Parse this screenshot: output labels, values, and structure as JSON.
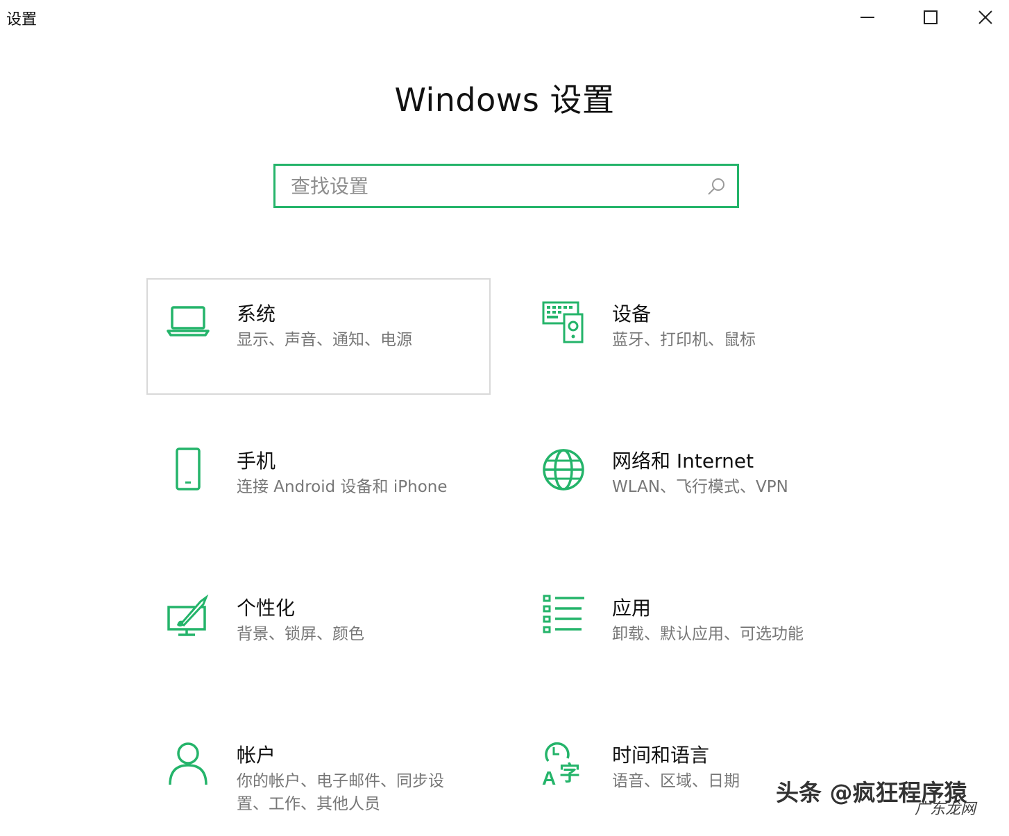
{
  "window": {
    "title": "设置"
  },
  "page": {
    "title": "Windows 设置"
  },
  "search": {
    "placeholder": "查找设置",
    "value": ""
  },
  "accent_color": "#24b46a",
  "tiles": [
    {
      "title": "系统",
      "desc": "显示、声音、通知、电源",
      "icon": "laptop-icon",
      "selected": true
    },
    {
      "title": "设备",
      "desc": "蓝牙、打印机、鼠标",
      "icon": "devices-icon"
    },
    {
      "title": "手机",
      "desc": "连接 Android 设备和 iPhone",
      "icon": "phone-icon"
    },
    {
      "title": "网络和 Internet",
      "desc": "WLAN、飞行模式、VPN",
      "icon": "globe-icon"
    },
    {
      "title": "个性化",
      "desc": "背景、锁屏、颜色",
      "icon": "personalization-icon"
    },
    {
      "title": "应用",
      "desc": "卸载、默认应用、可选功能",
      "icon": "apps-list-icon"
    },
    {
      "title": "帐户",
      "desc": "你的帐户、电子邮件、同步设置、工作、其他人员",
      "icon": "person-icon"
    },
    {
      "title": "时间和语言",
      "desc": "语音、区域、日期",
      "icon": "time-language-icon"
    }
  ],
  "watermark": {
    "main": "头条 @疯狂程序猿",
    "sub": "广东龙网"
  }
}
